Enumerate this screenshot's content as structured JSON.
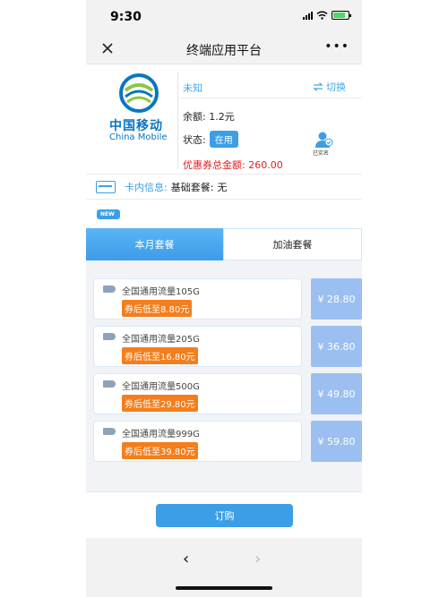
{
  "status_bar": {
    "time": "9:30"
  },
  "navbar": {
    "title": "终端应用平台",
    "more": "•••"
  },
  "account": {
    "brand_cn": "中国移动",
    "brand_en": "China Mobile",
    "number": "未知",
    "switch_label": "切换",
    "balance_label": "余额:",
    "balance_value": "1.2元",
    "status_label": "状态:",
    "status_value": "在用",
    "coupon_total_label": "优惠券总金额:",
    "coupon_total_value": "260.00",
    "verified_label": "已实名"
  },
  "card_info": {
    "label": "卡内信息:",
    "basic_label": "基础套餐:",
    "basic_value": "无"
  },
  "badge": "NEW",
  "tabs": [
    {
      "label": "本月套餐",
      "active": true
    },
    {
      "label": "加油套餐",
      "active": false
    }
  ],
  "packages": [
    {
      "name": "全国通用流量105G",
      "coupon": "券后低至8.80元",
      "price": "¥ 28.80"
    },
    {
      "name": "全国通用流量205G",
      "coupon": "券后低至16.80元",
      "price": "¥ 36.80"
    },
    {
      "name": "全国通用流量500G",
      "coupon": "券后低至29.80元",
      "price": "¥ 49.80"
    },
    {
      "name": "全国通用流量999G",
      "coupon": "券后低至39.80元",
      "price": "¥ 59.80"
    }
  ],
  "order_button": "订购",
  "browser": {
    "back": "‹",
    "forward": "›"
  },
  "colors": {
    "accent": "#3c9fe6",
    "coupon": "#f47e1c",
    "price_bg": "#9bbff0",
    "alert": "#e02020"
  }
}
